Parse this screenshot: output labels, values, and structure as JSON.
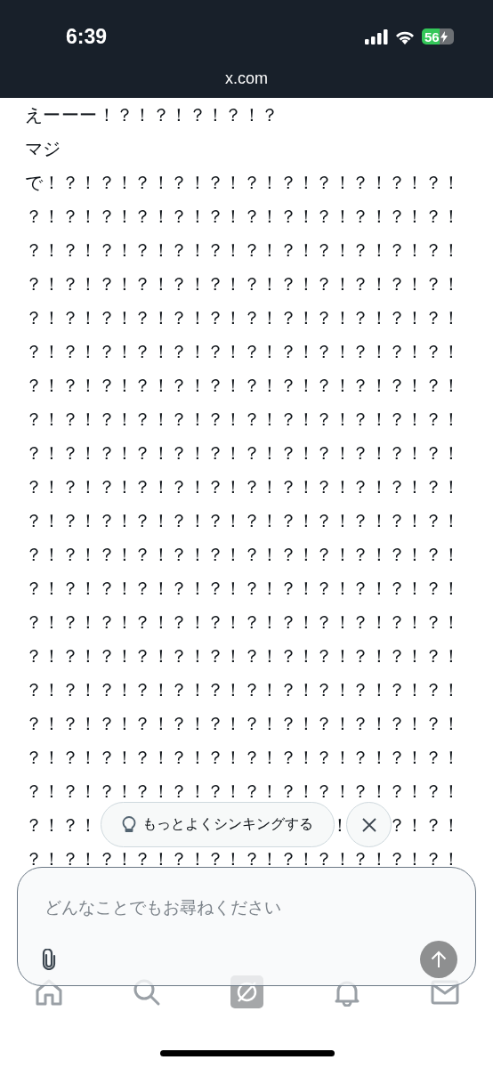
{
  "status_bar": {
    "time": "6:39",
    "battery": "56"
  },
  "address_bar": {
    "url": "x.com"
  },
  "post": {
    "lines": [
      {
        "segments": [
          "えーーー！？！？！？！？！？"
        ]
      },
      {
        "segments": [
          "マジ"
        ]
      },
      {
        "segments": [
          "で！？！？！？！？！？！？！？！？！？！？！？！"
        ]
      },
      {
        "segments": [
          "？！？！？！？！？！？！？！？！？！？！？！？！"
        ]
      },
      {
        "segments": [
          "？！？！？！？！？！？！？！？！？！？！？！？！"
        ]
      },
      {
        "segments": [
          "？！？！？！？！？！？！？！？！？！？！？！？！"
        ]
      },
      {
        "segments": [
          "？！？！？！？！？！？！？！？！？！？！？！？！"
        ]
      },
      {
        "segments": [
          "？！？！？！？！？！？！？！？！？！？！？！？！"
        ]
      },
      {
        "segments": [
          "？！？！？！？！？！？！？！？！？！？！？！？！"
        ]
      },
      {
        "segments": [
          "？！？！？！？！？！？！？！？！？！？！？！？！"
        ]
      },
      {
        "segments": [
          "？！？！？！？！？！？！？！？！？！？！？！？！"
        ]
      },
      {
        "segments": [
          "？！？！？！？！？！？！？！？！？！？！？！？！"
        ]
      },
      {
        "segments": [
          "？！？！？！？！？！？！？！？！？！？！？！？！"
        ]
      },
      {
        "segments": [
          "？！？！？！？！？！？！？！？！？！？！？！？！"
        ]
      },
      {
        "segments": [
          "？！？！？！？！？！？！？！？！？！？！？！？！"
        ]
      },
      {
        "segments": [
          "？！？！？！？！？！？！？！？！？！？！？！？！"
        ]
      },
      {
        "segments": [
          "？！？！？！？！？！？！？！？！？！？！？！？！"
        ]
      },
      {
        "segments": [
          "？！？！？！？！？！？！？！？！？！？！？！？！"
        ]
      },
      {
        "segments": [
          "？！？！？！？！？！？！？！？！？！？！？！？！"
        ]
      },
      {
        "segments": [
          "？！？！？！？！？！？！？！？！？！？！？！？！"
        ]
      },
      {
        "segments": [
          "？！？！？！？！？！？！？！？！？！？！？！？！"
        ]
      },
      {
        "segments": [
          "？！？！",
          "！",
          "？！？！"
        ]
      },
      {
        "segments": [
          "？！？！？！？！？！？！？！？！？！？！？！？！"
        ]
      }
    ]
  },
  "suggestion": {
    "label": "もっとよくシンキングする"
  },
  "composer": {
    "placeholder": "どんなことでもお尋ねください"
  },
  "nav": {
    "items": [
      {
        "kind": "home"
      },
      {
        "kind": "search"
      },
      {
        "kind": "grok"
      },
      {
        "kind": "bell"
      },
      {
        "kind": "mail"
      }
    ]
  }
}
